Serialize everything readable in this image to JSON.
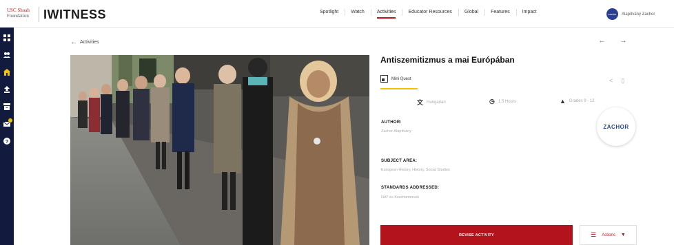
{
  "header": {
    "logo_line1": "USC Shoah",
    "logo_line2": "Foundation",
    "app_name": "IWITNESS",
    "nav": [
      {
        "label": "Spotlight"
      },
      {
        "label": "Watch"
      },
      {
        "label": "Activities",
        "active": true
      },
      {
        "label": "Educator Resources"
      },
      {
        "label": "Global"
      },
      {
        "label": "Features"
      },
      {
        "label": "Impact"
      }
    ],
    "user": {
      "avatar_text": "zachor",
      "name": "Alapítvány Zachor"
    }
  },
  "sidebar": {
    "icons": [
      "dashboard-icon",
      "users-icon",
      "home-icon",
      "upload-icon",
      "archive-icon",
      "mail-icon",
      "help-icon"
    ],
    "active": "home-icon",
    "badge_on": "mail-icon",
    "accent": "#f2c200"
  },
  "breadcrumb": {
    "label": "Activities"
  },
  "activity": {
    "title": "Antiszemitizmus a mai Európában",
    "type_label": "Mini Quest",
    "language": "Hungarian",
    "duration": "1.5 Hours",
    "grades": "Grades 9 - 12",
    "author_heading": "AUTHOR:",
    "author_value": "Zachor Alapítvány",
    "subject_heading": "SUBJECT AREA:",
    "subject_value": "European History, History, Social Studies",
    "standards_heading": "STANDARDS ADDRESSED:",
    "standards_value": "NAT és Kerettantervek",
    "logo_text": "ZACHOR"
  },
  "actions": {
    "revise_label": "REVISE ACTIVITY",
    "actions_label": "Actions"
  },
  "colors": {
    "brand_red": "#b3141c",
    "sidebar_bg": "#121a3d",
    "accent_yellow": "#f2c200"
  }
}
